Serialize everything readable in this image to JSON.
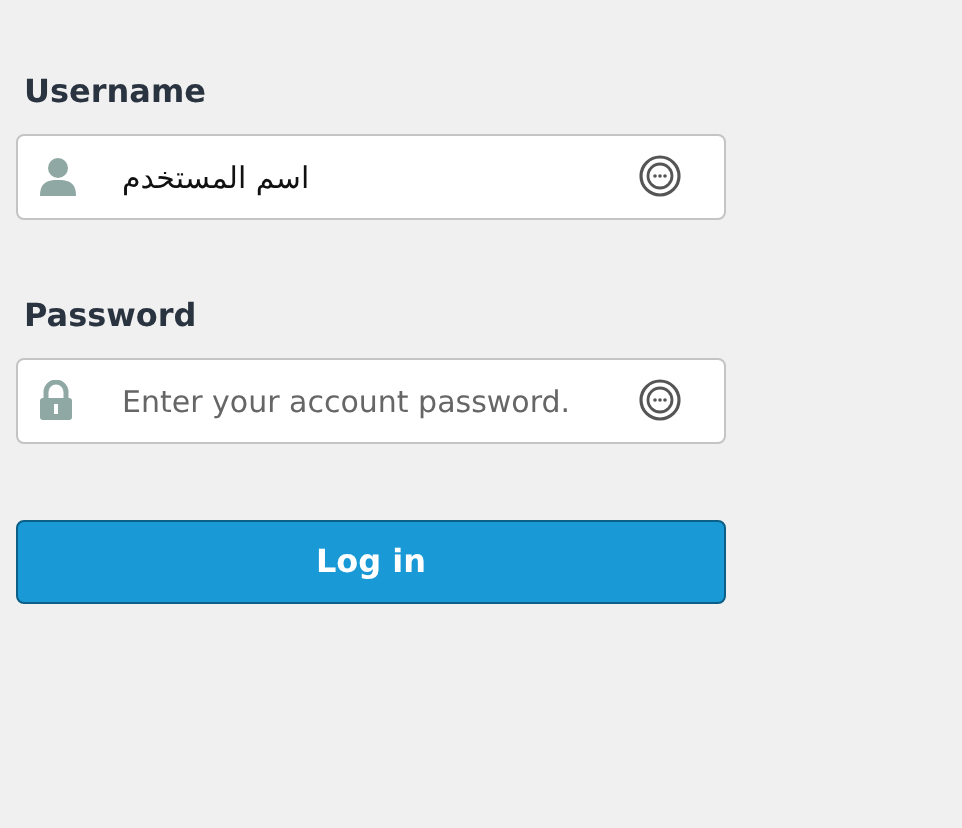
{
  "fields": [
    {
      "label": "Username",
      "kind": "user",
      "value": "اسم المستخدم"
    },
    {
      "label": "Password",
      "kind": "lock",
      "placeholder": "Enter your account password."
    }
  ],
  "button": "Log in"
}
